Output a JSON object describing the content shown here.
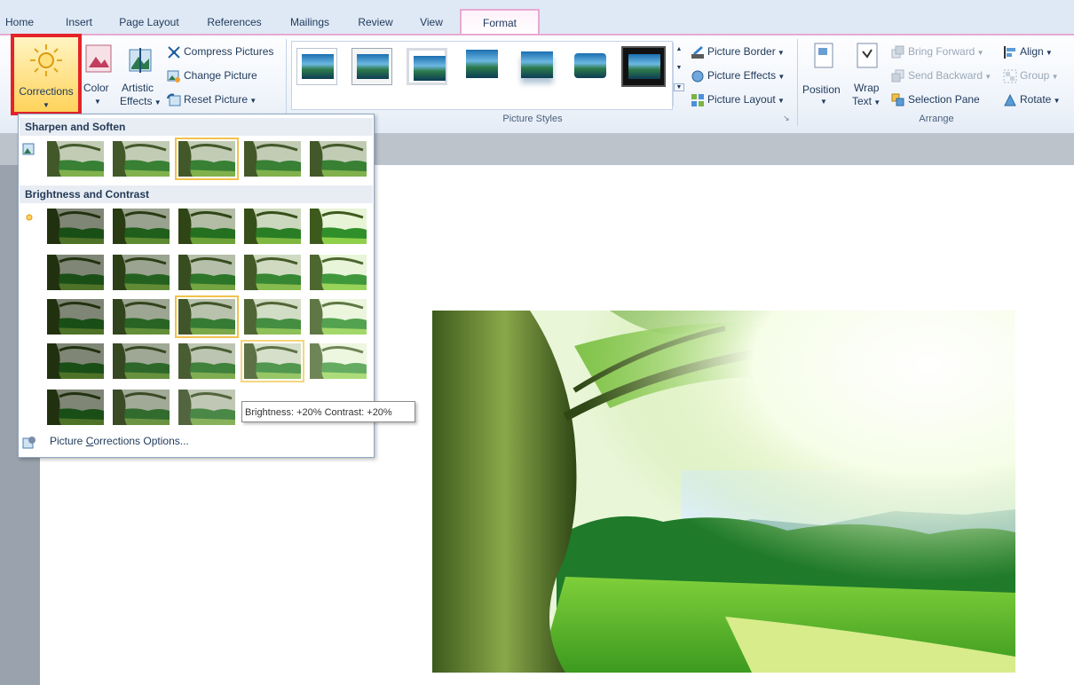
{
  "tabs": [
    {
      "label": "Home"
    },
    {
      "label": "Insert"
    },
    {
      "label": "Page Layout"
    },
    {
      "label": "References"
    },
    {
      "label": "Mailings"
    },
    {
      "label": "Review"
    },
    {
      "label": "View"
    },
    {
      "label": "Format"
    }
  ],
  "adjust": {
    "corrections_label": "Corrections",
    "color_label": "Color",
    "artistic_label_1": "Artistic",
    "artistic_label_2": "Effects",
    "compress_label": "Compress Pictures",
    "change_label": "Change Picture",
    "reset_label": "Reset Picture"
  },
  "picture_styles": {
    "group_label": "Picture Styles",
    "border_label": "Picture Border",
    "effects_label": "Picture Effects",
    "layout_label": "Picture Layout"
  },
  "arrange": {
    "group_label": "Arrange",
    "position_label": "Position",
    "wrap_label_1": "Wrap",
    "wrap_label_2": "Text",
    "bring_forward_label": "Bring Forward",
    "send_backward_label": "Send Backward",
    "selection_pane_label": "Selection Pane",
    "align_label": "Align",
    "group_btn_label": "Group",
    "rotate_label": "Rotate"
  },
  "gallery": {
    "section_sharpen": "Sharpen and Soften",
    "section_brightness": "Brightness and Contrast",
    "tooltip": "Brightness: +20% Contrast: +20%",
    "options_label_pre": "Picture ",
    "options_label_ul": "C",
    "options_label_post": "orrections Options..."
  },
  "colors": {
    "highlight_red": "#e4232a",
    "format_tab_accent": "#e7a9d1",
    "selection_gold": "#f2c24b"
  }
}
